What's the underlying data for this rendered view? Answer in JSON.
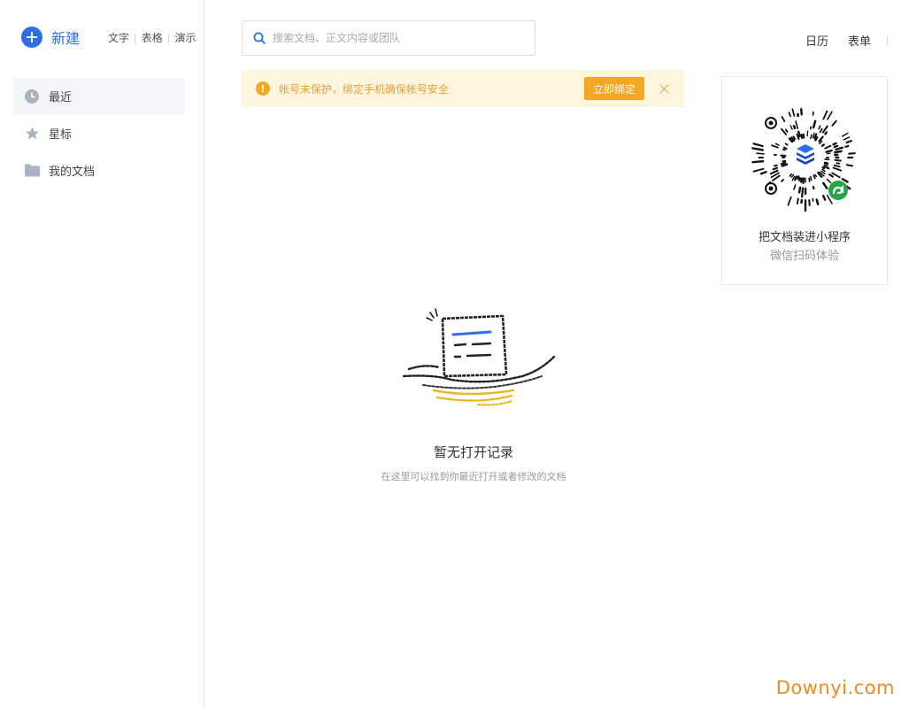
{
  "sidebar": {
    "new_label": "新建",
    "new_types": [
      "文字",
      "表格",
      "演示"
    ],
    "items": [
      {
        "label": "最近",
        "icon": "clock-icon",
        "active": true
      },
      {
        "label": "星标",
        "icon": "star-icon",
        "active": false
      },
      {
        "label": "我的文档",
        "icon": "folder-icon",
        "active": false
      }
    ]
  },
  "search": {
    "placeholder": "搜索文档、正文内容或团队"
  },
  "header": {
    "links": [
      "日历",
      "表单"
    ]
  },
  "warning": {
    "text": "帐号未保护，绑定手机确保帐号安全",
    "button_label": "立即绑定"
  },
  "qr_card": {
    "title": "把文档装进小程序",
    "subtitle": "微信扫码体验"
  },
  "empty_state": {
    "title": "暂无打开记录",
    "subtitle": "在这里可以找到你最近打开或者修改的文档"
  },
  "watermark": "Downyi.com",
  "colors": {
    "accent": "#2e6ee6",
    "warning_bg": "#fdf5dd",
    "warning_text": "#e8a036",
    "warning_button": "#f5a623",
    "nav_active_bg": "#f3f5f8",
    "watermark": "#f08a1c"
  }
}
